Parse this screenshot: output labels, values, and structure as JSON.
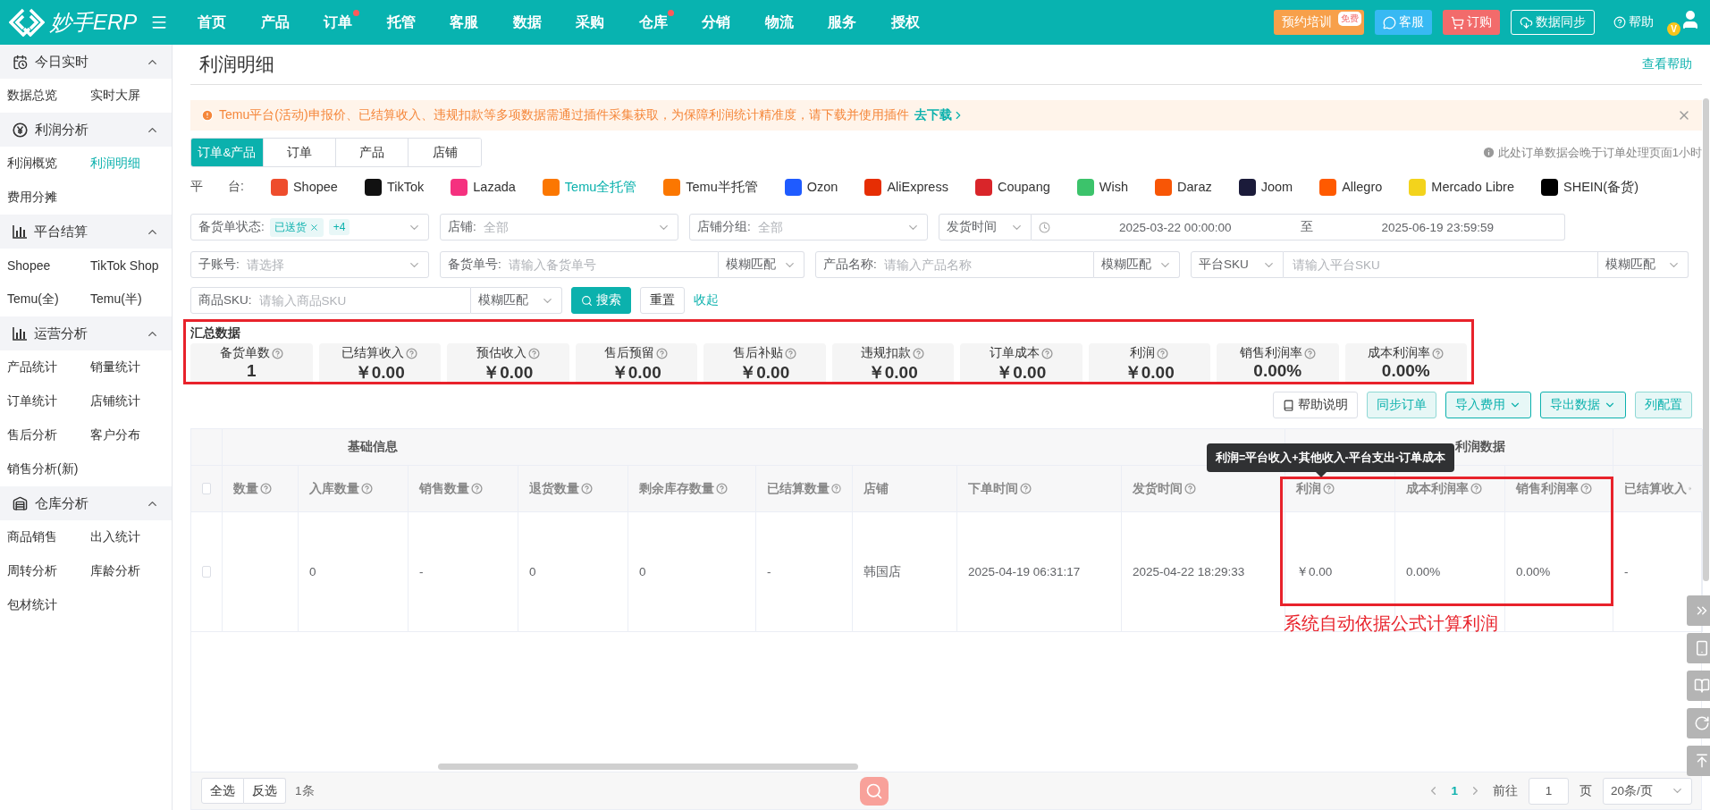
{
  "top_nav": {
    "logo": "妙手ERP",
    "items": [
      {
        "label": "首页",
        "dot": false
      },
      {
        "label": "产品",
        "dot": false
      },
      {
        "label": "订单",
        "dot": true
      },
      {
        "label": "托管",
        "dot": false
      },
      {
        "label": "客服",
        "dot": false
      },
      {
        "label": "数据",
        "dot": false
      },
      {
        "label": "采购",
        "dot": false
      },
      {
        "label": "仓库",
        "dot": true
      },
      {
        "label": "分销",
        "dot": false
      },
      {
        "label": "物流",
        "dot": false
      },
      {
        "label": "服务",
        "dot": false
      },
      {
        "label": "授权",
        "dot": false
      }
    ],
    "actions": [
      {
        "kind": "training",
        "label": "预约培训",
        "badge": "免费"
      },
      {
        "kind": "service",
        "label": "客服"
      },
      {
        "kind": "order",
        "label": "订购"
      },
      {
        "kind": "sync",
        "label": "数据同步"
      },
      {
        "kind": "help",
        "label": "帮助"
      }
    ],
    "avatar_badge": "V"
  },
  "sidebar": {
    "groups": [
      {
        "kind": "today",
        "title": "今日实时",
        "expanded": true,
        "items": [
          {
            "label": "数据总览",
            "selected": false
          },
          {
            "label": "实时大屏",
            "selected": false
          }
        ]
      },
      {
        "kind": "profit",
        "title": "利润分析",
        "expanded": true,
        "items": [
          {
            "label": "利润概览",
            "selected": false
          },
          {
            "label": "利润明细",
            "selected": true
          },
          {
            "label": "费用分摊",
            "selected": false
          }
        ]
      },
      {
        "kind": "chart",
        "title": "平台结算",
        "expanded": true,
        "items": [
          {
            "label": "Shopee",
            "selected": false
          },
          {
            "label": "TikTok Shop",
            "selected": false
          },
          {
            "label": "Temu(全)",
            "selected": false
          },
          {
            "label": "Temu(半)",
            "selected": false
          }
        ]
      },
      {
        "kind": "chart",
        "title": "运营分析",
        "expanded": true,
        "items": [
          {
            "label": "产品统计",
            "selected": false
          },
          {
            "label": "销量统计",
            "selected": false
          },
          {
            "label": "订单统计",
            "selected": false
          },
          {
            "label": "店铺统计",
            "selected": false
          },
          {
            "label": "售后分析",
            "selected": false
          },
          {
            "label": "客户分布",
            "selected": false
          },
          {
            "label": "销售分析(新)",
            "selected": false
          }
        ]
      },
      {
        "kind": "warehouse",
        "title": "仓库分析",
        "expanded": true,
        "items": [
          {
            "label": "商品销售",
            "selected": false
          },
          {
            "label": "出入统计",
            "selected": false
          },
          {
            "label": "周转分析",
            "selected": false
          },
          {
            "label": "库龄分析",
            "selected": false
          },
          {
            "label": "包材统计",
            "selected": false
          }
        ]
      }
    ]
  },
  "page": {
    "title": "利润明细",
    "help_link": "查看帮助"
  },
  "alert": {
    "text": "Temu平台(活动)申报价、已结算收入、违规扣款等多项数据需通过插件采集获取，为保障利润统计精准度，请下载并使用插件",
    "link": "去下载"
  },
  "tabs": [
    {
      "label": "订单&产品",
      "selected": true
    },
    {
      "label": "订单",
      "selected": false
    },
    {
      "label": "产品",
      "selected": false
    },
    {
      "label": "店铺",
      "selected": false
    }
  ],
  "note": "此处订单数据会晚于订单处理页面1小时",
  "platforms": {
    "label": "平　　台:",
    "items": [
      {
        "name": "Shopee",
        "color": "#ee4d2d",
        "selected": false
      },
      {
        "name": "TikTok",
        "color": "#111111",
        "selected": false
      },
      {
        "name": "Lazada",
        "color": "#f5317f",
        "selected": false
      },
      {
        "name": "Temu全托管",
        "color": "#fb7701",
        "selected": true
      },
      {
        "name": "Temu半托管",
        "color": "#fb7701",
        "selected": false
      },
      {
        "name": "Ozon",
        "color": "#1f5bff",
        "selected": false
      },
      {
        "name": "AliExpress",
        "color": "#e62e04",
        "selected": false
      },
      {
        "name": "Coupang",
        "color": "#d9252a",
        "selected": false
      },
      {
        "name": "Wish",
        "color": "#3cc36b",
        "selected": false
      },
      {
        "name": "Daraz",
        "color": "#f85606",
        "selected": false
      },
      {
        "name": "Joom",
        "color": "#1b1b3a",
        "selected": false
      },
      {
        "name": "Allegro",
        "color": "#ff5a00",
        "selected": false
      },
      {
        "name": "Mercado Libre",
        "color": "#f3d31c",
        "selected": false
      },
      {
        "name": "SHEIN(备货)",
        "color": "#000000",
        "selected": false
      }
    ]
  },
  "filters": {
    "status": {
      "label": "备货单状态:",
      "tag": "已送货",
      "more": "+4"
    },
    "store": {
      "label": "店铺:",
      "placeholder": "全部"
    },
    "store_group": {
      "label": "店铺分组:",
      "placeholder": "全部"
    },
    "date": {
      "type": "发货时间",
      "start": "2025-03-22 00:00:00",
      "separator": "至",
      "end": "2025-06-19 23:59:59"
    },
    "sub_account": {
      "label": "子账号:",
      "placeholder": "请选择"
    },
    "stock_no": {
      "label": "备货单号:",
      "placeholder": "请输入备货单号",
      "match": "模糊匹配"
    },
    "product_name": {
      "label": "产品名称:",
      "placeholder": "请输入产品名称",
      "match": "模糊匹配"
    },
    "platform_sku": {
      "type": "平台SKU",
      "placeholder": "请输入平台SKU",
      "match": "模糊匹配"
    },
    "product_sku": {
      "label": "商品SKU:",
      "placeholder": "请输入商品SKU",
      "match": "模糊匹配"
    },
    "search_button": "搜索",
    "reset_button": "重置",
    "collapse_link": "收起"
  },
  "summary": {
    "title": "汇总数据",
    "cards": [
      {
        "label": "备货单数",
        "value": "1"
      },
      {
        "label": "已结算收入",
        "value": "￥0.00"
      },
      {
        "label": "预估收入",
        "value": "￥0.00"
      },
      {
        "label": "售后预留",
        "value": "￥0.00"
      },
      {
        "label": "售后补贴",
        "value": "￥0.00"
      },
      {
        "label": "违规扣款",
        "value": "￥0.00"
      },
      {
        "label": "订单成本",
        "value": "￥0.00"
      },
      {
        "label": "利润",
        "value": "￥0.00"
      },
      {
        "label": "销售利润率",
        "value": "0.00%"
      },
      {
        "label": "成本利润率",
        "value": "0.00%"
      }
    ]
  },
  "toolbar": [
    {
      "kind": "help",
      "label": "帮助说明"
    },
    {
      "kind": "action",
      "label": "同步订单"
    },
    {
      "kind": "dropdown",
      "label": "导入费用"
    },
    {
      "kind": "dropdown",
      "label": "导出数据"
    },
    {
      "kind": "action",
      "label": "列配置"
    }
  ],
  "table": {
    "header_checked": false,
    "groups": [
      {
        "label": "基础信息",
        "columns": [
          {
            "label": "数量",
            "help": true
          },
          {
            "label": "入库数量",
            "help": true
          },
          {
            "label": "销售数量",
            "help": true
          },
          {
            "label": "退货数量",
            "help": true
          },
          {
            "label": "剩余库存数量",
            "help": true
          },
          {
            "label": "已结算数量",
            "help": true
          },
          {
            "label": "店铺",
            "help": false
          },
          {
            "label": "下单时间",
            "help": true
          },
          {
            "label": "发货时间",
            "help": true
          }
        ]
      },
      {
        "label": "利润数据",
        "columns": [
          {
            "label": "利润",
            "help": true
          },
          {
            "label": "成本利润率",
            "help": true
          },
          {
            "label": "销售利润率",
            "help": true
          }
        ]
      },
      {
        "columns": [
          {
            "label": "已结算收入",
            "help": true
          }
        ]
      }
    ],
    "rows": [
      {
        "selected": false,
        "cells": [
          "",
          "0",
          "-",
          "0",
          "0",
          "-",
          "韩国店",
          "2025-04-19 06:31:17",
          "2025-04-22 18:29:33",
          "￥0.00",
          "0.00%",
          "0.00%",
          "-"
        ]
      }
    ]
  },
  "annotations": {
    "tooltip": "利润=平台收入+其他收入-平台支出-订单成本",
    "note": "系统自动依据公式计算利润"
  },
  "footer": {
    "select_all": "全选",
    "invert": "反选",
    "count": "1条"
  },
  "pagination": {
    "pages": [
      {
        "label": "1",
        "selected": true
      }
    ],
    "goto": "前往",
    "page_input": "1",
    "page_unit": "页",
    "page_size": "20条/页"
  }
}
